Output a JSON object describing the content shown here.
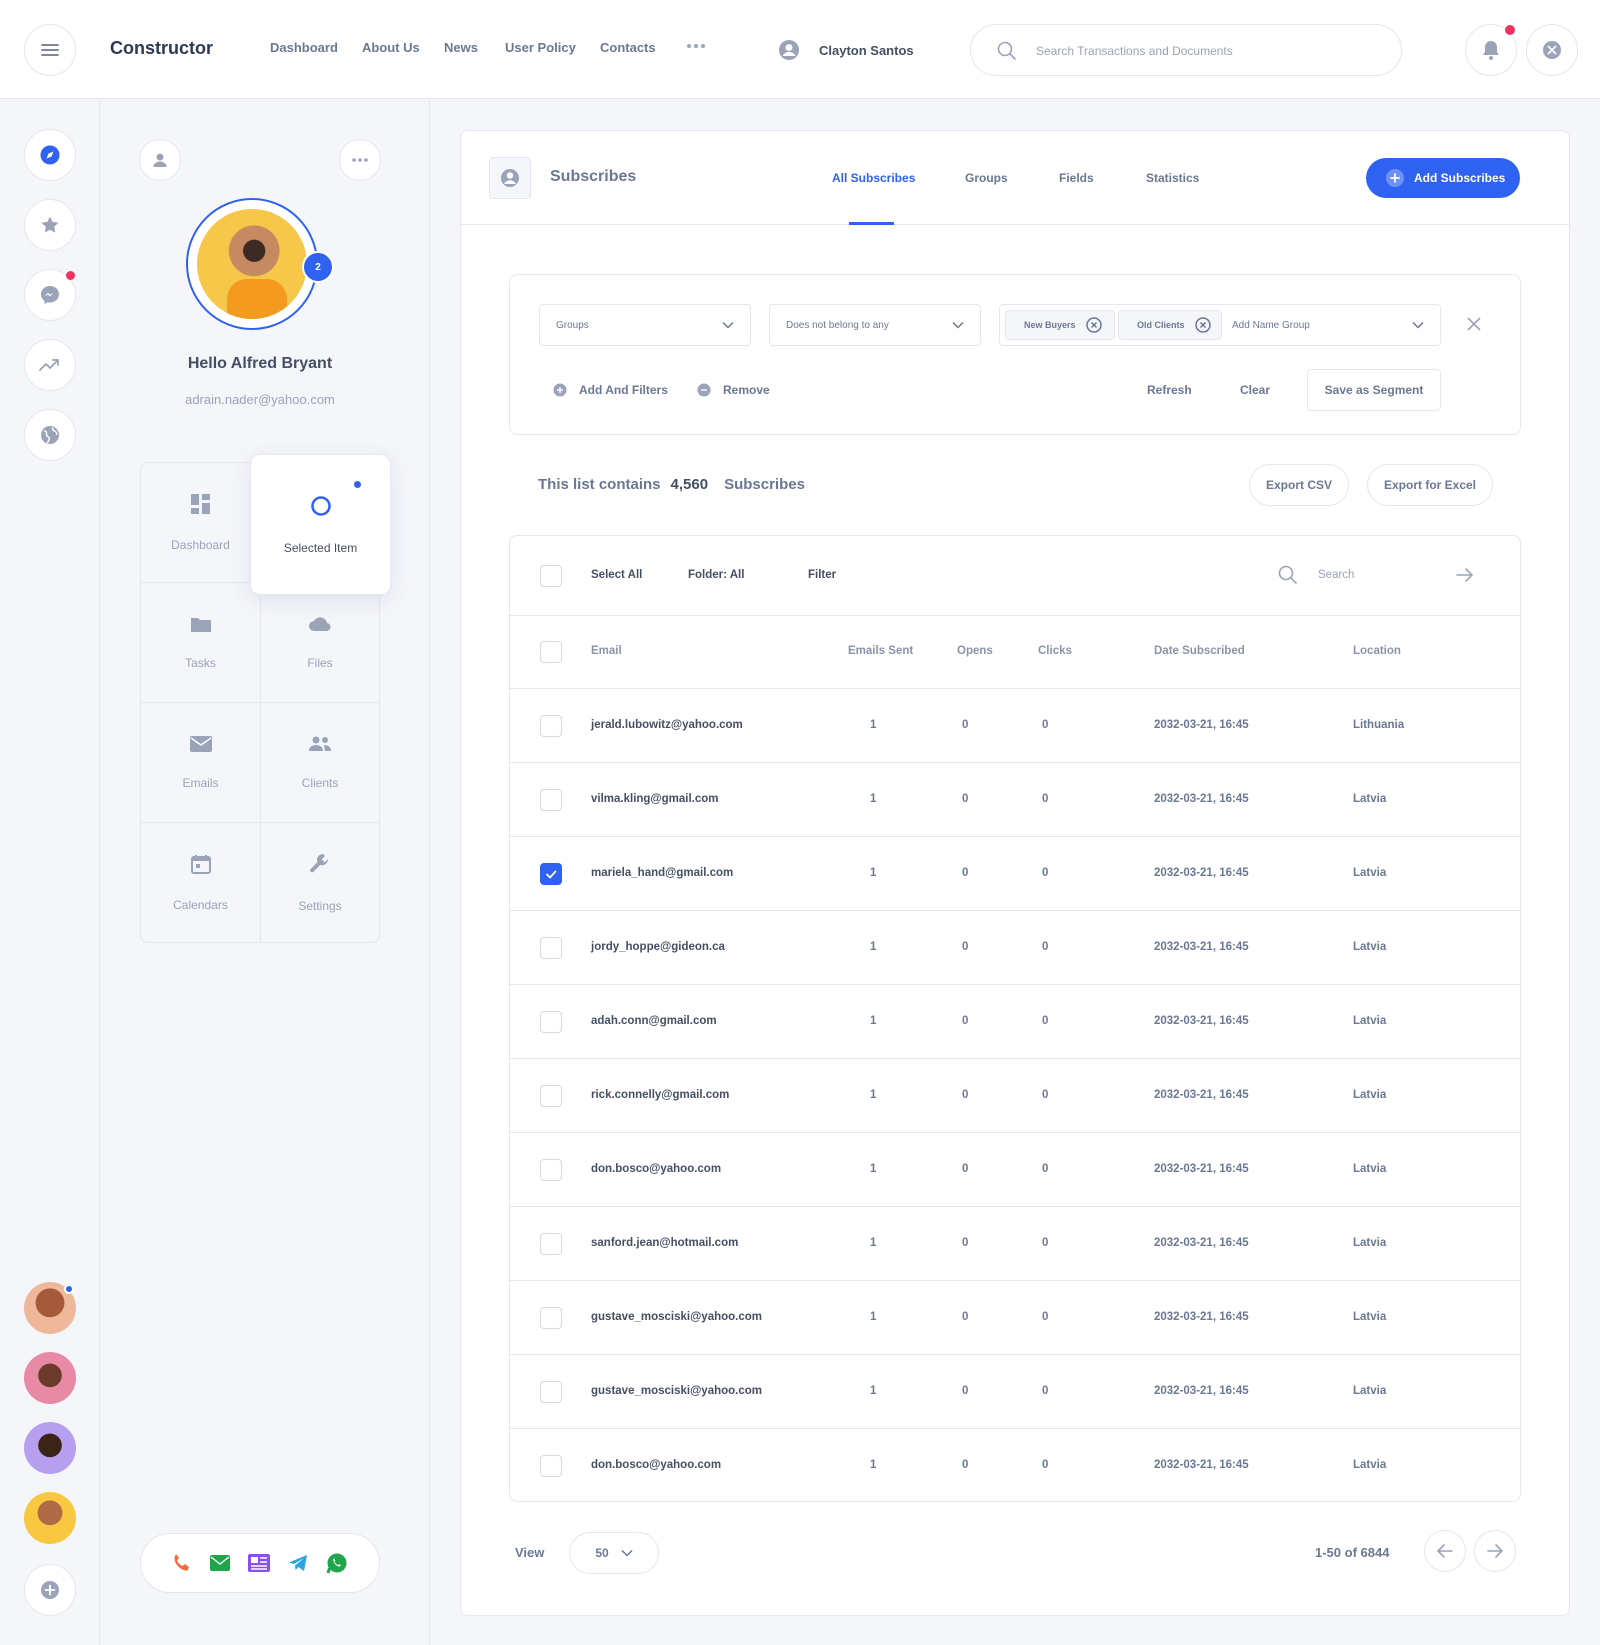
{
  "header": {
    "brand": "Constructor",
    "nav": [
      "Dashboard",
      "About Us",
      "News",
      "User Policy",
      "Contacts"
    ],
    "user_name": "Clayton Santos",
    "search_placeholder": "Search Transactions and Documents"
  },
  "profile": {
    "badge_count": "2",
    "greeting": "Hello Alfred Bryant",
    "email": "adrain.nader@yahoo.com",
    "menu": {
      "dashboard": "Dashboard",
      "selected": "Selected Item",
      "tasks": "Tasks",
      "files": "Files",
      "emails": "Emails",
      "clients": "Clients",
      "calendars": "Calendars",
      "settings": "Settings"
    }
  },
  "main": {
    "title": "Subscribes",
    "tabs": [
      "All Subscribes",
      "Groups",
      "Fields",
      "Statistics"
    ],
    "active_tab": "All Subscribes",
    "add_button": "Add Subscribes",
    "filters": {
      "group_select": "Groups",
      "membership_select": "Does not belong to any",
      "chips": [
        "New Buyers",
        "Old Clients"
      ],
      "add_group_placeholder": "Add Name Group",
      "add_filters": "Add And Filters",
      "remove": "Remove",
      "refresh": "Refresh",
      "clear": "Clear",
      "save_segment": "Save as Segment"
    },
    "summary": {
      "prefix": "This list contains",
      "count": "4,560",
      "suffix": "Subscribes"
    },
    "export_csv": "Export CSV",
    "export_excel": "Export for Excel",
    "toolbar": {
      "select_all": "Select All",
      "folder": "Folder: All",
      "filter": "Filter",
      "search_placeholder": "Search"
    },
    "columns": [
      "Email",
      "Emails Sent",
      "Opens",
      "Clicks",
      "Date Subscribed",
      "Location"
    ],
    "rows": [
      {
        "email": "jerald.lubowitz@yahoo.com",
        "sent": "1",
        "opens": "0",
        "clicks": "0",
        "date": "2032-03-21, 16:45",
        "location": "Lithuania",
        "checked": false
      },
      {
        "email": "vilma.kling@gmail.com",
        "sent": "1",
        "opens": "0",
        "clicks": "0",
        "date": "2032-03-21, 16:45",
        "location": "Latvia",
        "checked": false
      },
      {
        "email": "mariela_hand@gmail.com",
        "sent": "1",
        "opens": "0",
        "clicks": "0",
        "date": "2032-03-21, 16:45",
        "location": "Latvia",
        "checked": true
      },
      {
        "email": "jordy_hoppe@gideon.ca",
        "sent": "1",
        "opens": "0",
        "clicks": "0",
        "date": "2032-03-21, 16:45",
        "location": "Latvia",
        "checked": false
      },
      {
        "email": "adah.conn@gmail.com",
        "sent": "1",
        "opens": "0",
        "clicks": "0",
        "date": "2032-03-21, 16:45",
        "location": "Latvia",
        "checked": false
      },
      {
        "email": "rick.connelly@gmail.com",
        "sent": "1",
        "opens": "0",
        "clicks": "0",
        "date": "2032-03-21, 16:45",
        "location": "Latvia",
        "checked": false
      },
      {
        "email": "don.bosco@yahoo.com",
        "sent": "1",
        "opens": "0",
        "clicks": "0",
        "date": "2032-03-21, 16:45",
        "location": "Latvia",
        "checked": false
      },
      {
        "email": "sanford.jean@hotmail.com",
        "sent": "1",
        "opens": "0",
        "clicks": "0",
        "date": "2032-03-21, 16:45",
        "location": "Latvia",
        "checked": false
      },
      {
        "email": "gustave_mosciski@yahoo.com",
        "sent": "1",
        "opens": "0",
        "clicks": "0",
        "date": "2032-03-21, 16:45",
        "location": "Latvia",
        "checked": false
      },
      {
        "email": "gustave_mosciski@yahoo.com",
        "sent": "1",
        "opens": "0",
        "clicks": "0",
        "date": "2032-03-21, 16:45",
        "location": "Latvia",
        "checked": false
      },
      {
        "email": "don.bosco@yahoo.com",
        "sent": "1",
        "opens": "0",
        "clicks": "0",
        "date": "2032-03-21, 16:45",
        "location": "Latvia",
        "checked": false
      }
    ],
    "pagination": {
      "view_label": "View",
      "per_page": "50",
      "range": "1-50 of 6844"
    }
  },
  "colors": {
    "accent": "#2f62f0",
    "notification": "#f0325f",
    "text": "#454f63",
    "muted": "#9aa3b8"
  },
  "icons": [
    "menu-icon",
    "more-icon",
    "user-icon",
    "search-icon",
    "bell-icon",
    "close-icon",
    "compass-icon",
    "star-icon",
    "messenger-icon",
    "trend-icon",
    "globe-icon",
    "plus-icon",
    "phone-icon",
    "mail-icon",
    "news-icon",
    "telegram-icon",
    "whatsapp-icon"
  ]
}
